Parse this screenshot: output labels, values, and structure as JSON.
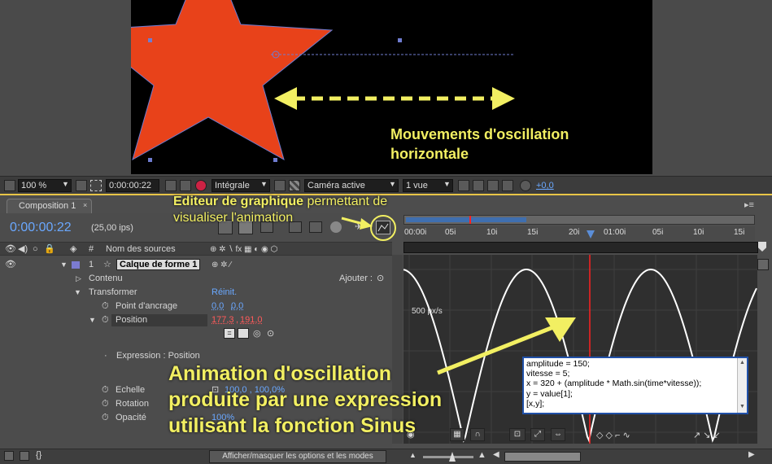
{
  "annotations": {
    "oscillation_title_line1": "Mouvements d'oscillation",
    "oscillation_title_line2": "horizontale",
    "graph_editor_bold": "Editeur de graphique",
    "graph_editor_rest": " permettant de",
    "graph_editor_line2": "visualiser l'animation",
    "expression_line1": "Animation d'oscillation",
    "expression_line2": "produite par une expression",
    "expression_line3": "utilisant la fonction Sinus"
  },
  "viewer_toolbar": {
    "zoom": "100 %",
    "timecode": "0:00:00:22",
    "resolution": "Intégrale",
    "camera": "Caméra active",
    "views": "1 vue",
    "exposure": "+0,0"
  },
  "timeline": {
    "tab_label": "Composition 1",
    "current_time": "0:00:00:22",
    "fps": "(25,00 ips)",
    "ruler_ticks": [
      "00:00i",
      "05i",
      "10i",
      "15i",
      "20i",
      "01:00i",
      "05i",
      "10i",
      "15i"
    ],
    "columns": {
      "hash": "#",
      "source_name": "Nom des sources"
    },
    "layer": {
      "number": "1",
      "name": "Calque de forme 1"
    },
    "contenu": "Contenu",
    "ajouter": "Ajouter :",
    "transformer": "Transformer",
    "reinit": "Réinit.",
    "anchor_label": "Point d'ancrage",
    "anchor_x": "0,0",
    "anchor_y": "0,0",
    "position_label": "Position",
    "position_x": "177,3",
    "position_y": "191,0",
    "expression_label": "Expression : Position",
    "scale_label": "Echelle",
    "scale_value": "100,0 , 100,0%",
    "rotation_label": "Rotation",
    "opacity_label": "Opacité",
    "opacity_value": "100%",
    "graph_unit": "500 px/s",
    "toggle_label": "Afficher/masquer les options et les modes"
  },
  "expression_code": "amplitude = 150;\nvitesse = 5;\nx = 320 + (amplitude * Math.sin(time*vitesse));\ny = value[1];\n[x,y];",
  "colors": {
    "annotation_yellow": "#f2ef62",
    "star_fill": "#e8421a",
    "curve": "#ffffff",
    "current_time_indicator": "#ff2020"
  }
}
